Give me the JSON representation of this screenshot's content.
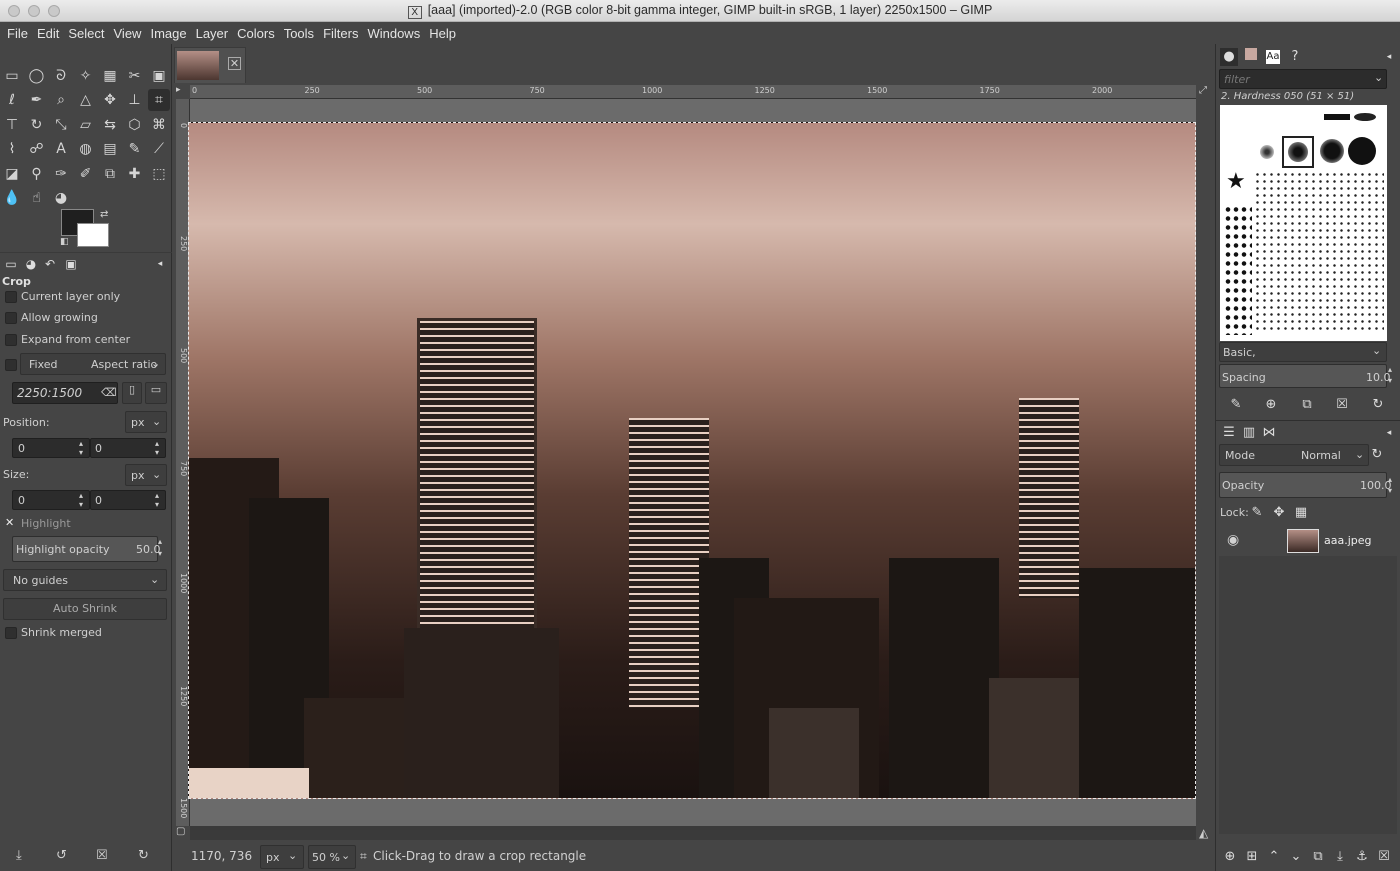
{
  "window": {
    "title": "[aaa] (imported)-2.0 (RGB color 8-bit gamma integer, GIMP built-in sRGB, 1 layer) 2250x1500 – GIMP",
    "x11_badge": "X"
  },
  "menubar": [
    "File",
    "Edit",
    "Select",
    "View",
    "Image",
    "Layer",
    "Colors",
    "Tools",
    "Filters",
    "Windows",
    "Help"
  ],
  "toolbox": {
    "tools": [
      {
        "name": "rect-select",
        "glyph": "▭"
      },
      {
        "name": "ellipse-select",
        "glyph": "◯"
      },
      {
        "name": "free-select",
        "glyph": "ᘐ"
      },
      {
        "name": "fuzzy-select",
        "glyph": "✧"
      },
      {
        "name": "by-color-select",
        "glyph": "▦"
      },
      {
        "name": "scissors-select",
        "glyph": "✂"
      },
      {
        "name": "foreground-select",
        "glyph": "▣"
      },
      {
        "name": "paths",
        "glyph": "ℓ"
      },
      {
        "name": "color-picker",
        "glyph": "✒"
      },
      {
        "name": "zoom",
        "glyph": "⌕"
      },
      {
        "name": "measure",
        "glyph": "△"
      },
      {
        "name": "move",
        "glyph": "✥"
      },
      {
        "name": "align",
        "glyph": "⊥"
      },
      {
        "name": "crop",
        "glyph": "⌗"
      },
      {
        "name": "unified-transform",
        "glyph": "⊤"
      },
      {
        "name": "rotate",
        "glyph": "↻"
      },
      {
        "name": "scale",
        "glyph": "⤡"
      },
      {
        "name": "shear",
        "glyph": "▱"
      },
      {
        "name": "flip",
        "glyph": "⇆"
      },
      {
        "name": "perspective",
        "glyph": "⬡"
      },
      {
        "name": "cage",
        "glyph": "⌘"
      },
      {
        "name": "warp",
        "glyph": "⌇"
      },
      {
        "name": "handle-transform",
        "glyph": "☍"
      },
      {
        "name": "text",
        "glyph": "A"
      },
      {
        "name": "bucket-fill",
        "glyph": "◍"
      },
      {
        "name": "gradient",
        "glyph": "▤"
      },
      {
        "name": "pencil",
        "glyph": "✎"
      },
      {
        "name": "paintbrush",
        "glyph": "⟋"
      },
      {
        "name": "eraser",
        "glyph": "◪"
      },
      {
        "name": "airbrush",
        "glyph": "⚲"
      },
      {
        "name": "ink",
        "glyph": "✑"
      },
      {
        "name": "mypaint-brush",
        "glyph": "✐"
      },
      {
        "name": "clone",
        "glyph": "⧉"
      },
      {
        "name": "heal",
        "glyph": "✚"
      },
      {
        "name": "perspective-clone",
        "glyph": "⬚"
      },
      {
        "name": "blur",
        "glyph": "💧"
      },
      {
        "name": "smudge",
        "glyph": "☝"
      },
      {
        "name": "dodge-burn",
        "glyph": "◕"
      }
    ],
    "fg_color": "#1f1f1f",
    "bg_color": "#ffffff"
  },
  "tool_options": {
    "title": "Crop",
    "current_layer_only": "Current layer only",
    "allow_growing": "Allow growing",
    "expand_from_center": "Expand from center",
    "fixed": "Fixed",
    "aspect_ratio": "Aspect ratio",
    "ratio_value": "2250:1500",
    "position_label": "Position:",
    "position_unit": "px",
    "position_x": "0",
    "position_y": "0",
    "size_label": "Size:",
    "size_unit": "px",
    "size_w": "0",
    "size_h": "0",
    "highlight": "Highlight",
    "highlight_opacity_label": "Highlight opacity",
    "highlight_opacity_value": "50.0",
    "guides": "No guides",
    "auto_shrink": "Auto Shrink",
    "shrink_merged": "Shrink merged"
  },
  "canvas": {
    "ruler_h": [
      "0",
      "250",
      "500",
      "750",
      "1000",
      "1250",
      "1500",
      "1750",
      "2000"
    ],
    "ruler_v": [
      "0",
      "250",
      "500",
      "750",
      "1000",
      "1250",
      "1500"
    ],
    "photo_colors": {
      "sky_top": "#b58a80",
      "sky_mid": "#d6b9ad",
      "city": "#5a3d33",
      "dark": "#1a1210"
    }
  },
  "statusbar": {
    "coords": "1170, 736",
    "unit": "px",
    "zoom": "50 %",
    "message": "Click-Drag to draw a crop rectangle"
  },
  "brushes": {
    "filter_placeholder": "filter",
    "selected_brush": "2. Hardness 050 (51 × 51)",
    "tag": "Basic,",
    "spacing_label": "Spacing",
    "spacing_value": "10.0"
  },
  "layers": {
    "mode_label": "Mode",
    "mode_value": "Normal",
    "opacity_label": "Opacity",
    "opacity_value": "100.0",
    "lock_label": "Lock:",
    "items": [
      {
        "name": "aaa.jpeg"
      }
    ]
  }
}
